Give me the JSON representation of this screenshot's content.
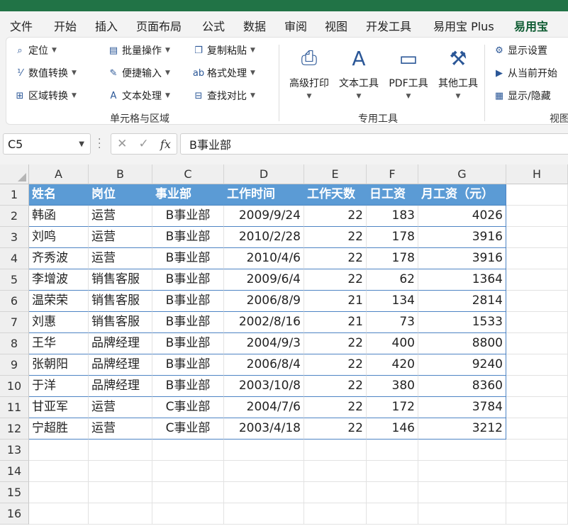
{
  "ribbon_tabs": [
    "文件",
    "开始",
    "插入",
    "页面布局",
    "公式",
    "数据",
    "审阅",
    "视图",
    "开发工具",
    "易用宝 Plus",
    "易用宝"
  ],
  "active_tab": "易用宝",
  "group1": {
    "col1": [
      {
        "label": "定位",
        "icon": "locate-icon"
      },
      {
        "label": "数值转换",
        "icon": "number-convert-icon"
      },
      {
        "label": "区域转换",
        "icon": "range-convert-icon"
      }
    ],
    "col2": [
      {
        "label": "批量操作",
        "icon": "batch-icon"
      },
      {
        "label": "便捷输入",
        "icon": "quick-input-icon"
      },
      {
        "label": "文本处理",
        "icon": "text-process-icon"
      }
    ],
    "col3": [
      {
        "label": "复制粘贴",
        "icon": "copy-paste-icon"
      },
      {
        "label": "格式处理",
        "icon": "format-icon"
      },
      {
        "label": "查找对比",
        "icon": "compare-icon"
      }
    ],
    "label": "单元格与区域"
  },
  "group2": {
    "buttons": [
      {
        "label": "高级打印",
        "icon": "print-icon"
      },
      {
        "label": "文本工具",
        "icon": "text-tool-icon"
      },
      {
        "label": "PDF工具",
        "icon": "pdf-icon"
      },
      {
        "label": "其他工具",
        "icon": "toolbox-icon"
      }
    ],
    "label": "专用工具"
  },
  "group3": {
    "items": [
      {
        "label": "显示设置",
        "icon": "display-settings-icon"
      },
      {
        "label": "从当前开始",
        "icon": "from-current-icon"
      },
      {
        "label": "显示/隐藏",
        "icon": "show-hide-icon"
      }
    ],
    "label": "视图"
  },
  "formula_bar": {
    "name_box": "C5",
    "formula": "B事业部"
  },
  "columns": [
    "A",
    "B",
    "C",
    "D",
    "E",
    "F",
    "G",
    "H"
  ],
  "rows": [
    "1",
    "2",
    "3",
    "4",
    "5",
    "6",
    "7",
    "8",
    "9",
    "10",
    "11",
    "12",
    "13",
    "14",
    "15",
    "16"
  ],
  "table_header": [
    "姓名",
    "岗位",
    "事业部",
    "工作时间",
    "工作天数",
    "日工资",
    "月工资（元）"
  ],
  "table_rows": [
    [
      "韩函",
      "运营",
      "B事业部",
      "2009/9/24",
      "22",
      "183",
      "4026"
    ],
    [
      "刘鸣",
      "运营",
      "B事业部",
      "2010/2/28",
      "22",
      "178",
      "3916"
    ],
    [
      "齐秀波",
      "运营",
      "B事业部",
      "2010/4/6",
      "22",
      "178",
      "3916"
    ],
    [
      "李增波",
      "销售客服",
      "B事业部",
      "2009/6/4",
      "22",
      "62",
      "1364"
    ],
    [
      "温荣荣",
      "销售客服",
      "B事业部",
      "2006/8/9",
      "21",
      "134",
      "2814"
    ],
    [
      "刘惠",
      "销售客服",
      "B事业部",
      "2002/8/16",
      "21",
      "73",
      "1533"
    ],
    [
      "王华",
      "品牌经理",
      "B事业部",
      "2004/9/3",
      "22",
      "400",
      "8800"
    ],
    [
      "张朝阳",
      "品牌经理",
      "B事业部",
      "2006/8/4",
      "22",
      "420",
      "9240"
    ],
    [
      "于洋",
      "品牌经理",
      "B事业部",
      "2003/10/8",
      "22",
      "380",
      "8360"
    ],
    [
      "甘亚军",
      "运营",
      "C事业部",
      "2004/7/6",
      "22",
      "172",
      "3784"
    ],
    [
      "宁超胜",
      "运营",
      "C事业部",
      "2003/4/18",
      "22",
      "146",
      "3212"
    ]
  ],
  "colors": {
    "accent": "#217346",
    "table_header_bg": "#5b9bd5",
    "table_border": "#4e84c4"
  }
}
